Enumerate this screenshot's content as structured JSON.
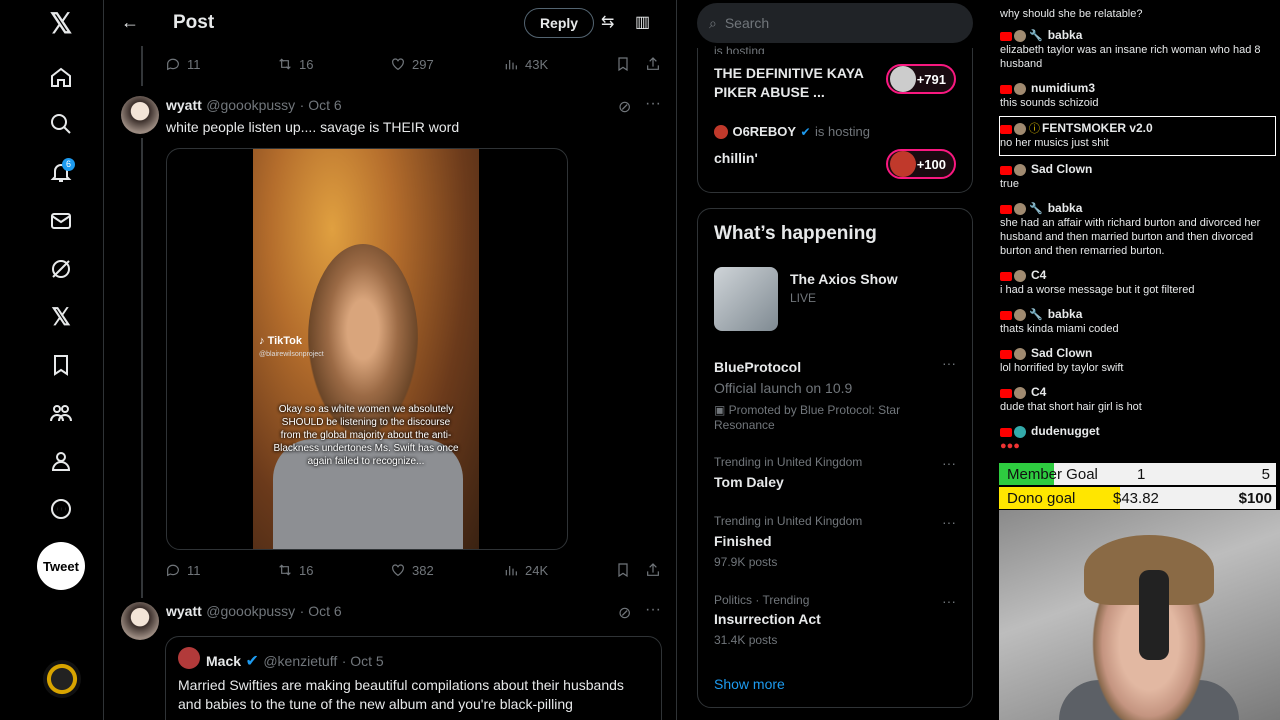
{
  "nav": {
    "notif_count": "6",
    "tweet_label": "Tweet"
  },
  "header": {
    "title": "Post",
    "reply_label": "Reply"
  },
  "tweet0": {
    "replies": "11",
    "retweets": "16",
    "likes": "297",
    "views": "43K"
  },
  "tweet1": {
    "name": "wyatt",
    "handle": "@goookpussy",
    "date": "· Oct 6",
    "text": "white people listen up.... savage is THEIR word",
    "video": {
      "watermark": "TikTok",
      "watermark_handle": "@blairewilsonproject",
      "caption": "Okay so as white women we absolutely SHOULD be listening to the discourse from the global majority about the anti-Blackness undertones Ms. Swift has once again failed to recognize..."
    },
    "replies": "11",
    "retweets": "16",
    "likes": "382",
    "views": "24K"
  },
  "tweet2": {
    "name": "wyatt",
    "handle": "@goookpussy",
    "date": "· Oct 6",
    "quote": {
      "name": "Mack",
      "handle": "@kenzietuff",
      "date": "· Oct 5",
      "text": "Married Swifties are making beautiful compilations about their husbands and babies to the tune of the new album and you're black-pilling"
    }
  },
  "search": {
    "placeholder": "Search"
  },
  "spaces": {
    "host_line": "is hosting",
    "space1_title": "THE DEFINITIVE KAYA PIKER ABUSE ...",
    "space1_count": "+791",
    "space2_host": "O6REBOY",
    "space2_title": "chillin'",
    "space2_count": "+100"
  },
  "happening": {
    "title": "What’s happening",
    "live_title": "The Axios Show",
    "live_tag": "LIVE",
    "trends": [
      {
        "name": "BlueProtocol",
        "sub": "Official launch on 10.9",
        "meta": "Promoted by Blue Protocol: Star Resonance"
      },
      {
        "context": "Trending in United Kingdom",
        "name": "Tom Daley"
      },
      {
        "context": "Trending in United Kingdom",
        "name": "Finished",
        "posts": "97.9K posts"
      },
      {
        "context": "Politics · Trending",
        "name": "Insurrection Act",
        "posts": "31.4K posts"
      }
    ],
    "show_more": "Show more"
  },
  "chat": [
    {
      "text": "why should she be relatable?"
    },
    {
      "name": "babka",
      "text": "elizabeth taylor was an insane rich woman who had 8 husband"
    },
    {
      "name": "numidium3",
      "text": "this sounds schizoid"
    },
    {
      "name": "FENTSMOKER v2.0",
      "text": "no her musics just shit"
    },
    {
      "name": "Sad Clown",
      "text": "true"
    },
    {
      "name": "babka",
      "text": "she had an affair with richard burton and divorced her husband and then married burton and then divorced burton and then remarried burton."
    },
    {
      "name": "C4",
      "text": "i had a worse message but it got filtered"
    },
    {
      "name": "babka",
      "text": "thats kinda miami coded"
    },
    {
      "name": "Sad Clown",
      "text": "lol horrified by taylor swift"
    },
    {
      "name": "C4",
      "text": "dude that short hair girl is hot"
    },
    {
      "name": "dudenugget"
    }
  ],
  "goals": {
    "member_label": "Member Goal",
    "member_current": "1",
    "member_target": "5",
    "member_progress": 0.2,
    "dono_label": "Dono goal",
    "dono_current": "$43.82",
    "dono_target": "$100",
    "dono_progress": 0.4382
  },
  "colors": {
    "accent": "#1d9bf0",
    "live": "#f91880",
    "member_fill": "#2ecc40",
    "dono_fill": "#ffe600"
  }
}
